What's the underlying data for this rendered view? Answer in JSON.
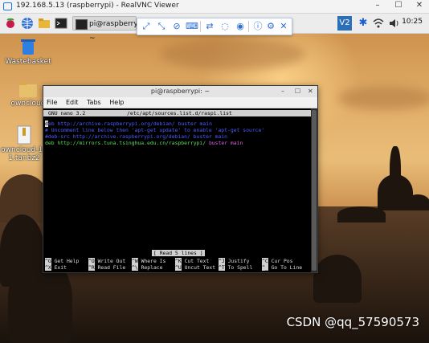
{
  "vnc_window": {
    "title": "192.168.5.13 (raspberrypi) - RealVNC Viewer",
    "controls": [
      "–",
      "☐",
      "✕"
    ]
  },
  "panel": {
    "task_label": "pi@raspberrypi: ~",
    "clock": "10:25",
    "vnc_tray_label": "V2"
  },
  "vnc_toolbar": {
    "icons": [
      "fullscreen-icon",
      "scale-icon",
      "mute-icon",
      "send-keys-icon",
      "transfer-icon",
      "chat-icon",
      "record-icon",
      "info-icon",
      "settings-icon",
      "close-icon"
    ]
  },
  "desktop": {
    "icons": [
      {
        "label": "Wastebasket",
        "icon": "wastebasket-icon"
      },
      {
        "label": "owncloud",
        "icon": "folder-icon"
      },
      {
        "label": "owncloud-10 1.tar.bz2",
        "icon": "archive-icon"
      }
    ]
  },
  "terminal": {
    "title": "pi@raspberrypi: ~",
    "menu": [
      "File",
      "Edit",
      "Tabs",
      "Help"
    ],
    "nano_version": "GNU nano 3.2",
    "file_path": "/etc/apt/sources.list.d/raspi.list",
    "lines": [
      {
        "prefix": "d",
        "text": "eb http://archive.raspberrypi.org/debian/ buster main"
      },
      {
        "text": "# Uncomment line below then 'apt-get update' to enable 'apt-get source'"
      },
      {
        "text": "#deb-src http://archive.raspberrypi.org/debian/ buster main"
      },
      {
        "keyword": "deb",
        "url": "http://mirrors.tuna.tsinghua.edu.cn/raspberrypi/",
        "suite": "buster",
        "component": "main"
      }
    ],
    "status": "[ Read 5 lines ]",
    "shortcuts_row1": [
      {
        "key": "^G",
        "label": "Get Help"
      },
      {
        "key": "^O",
        "label": "Write Out"
      },
      {
        "key": "^W",
        "label": "Where Is"
      },
      {
        "key": "^K",
        "label": "Cut Text"
      },
      {
        "key": "^J",
        "label": "Justify"
      },
      {
        "key": "^C",
        "label": "Cur Pos"
      }
    ],
    "shortcuts_row2": [
      {
        "key": "^X",
        "label": "Exit"
      },
      {
        "key": "^R",
        "label": "Read File"
      },
      {
        "key": "^\\",
        "label": "Replace"
      },
      {
        "key": "^U",
        "label": "Uncut Text"
      },
      {
        "key": "^T",
        "label": "To Spell"
      },
      {
        "key": "^_",
        "label": "Go To Line"
      }
    ]
  },
  "watermark": "CSDN @qq_57590573"
}
